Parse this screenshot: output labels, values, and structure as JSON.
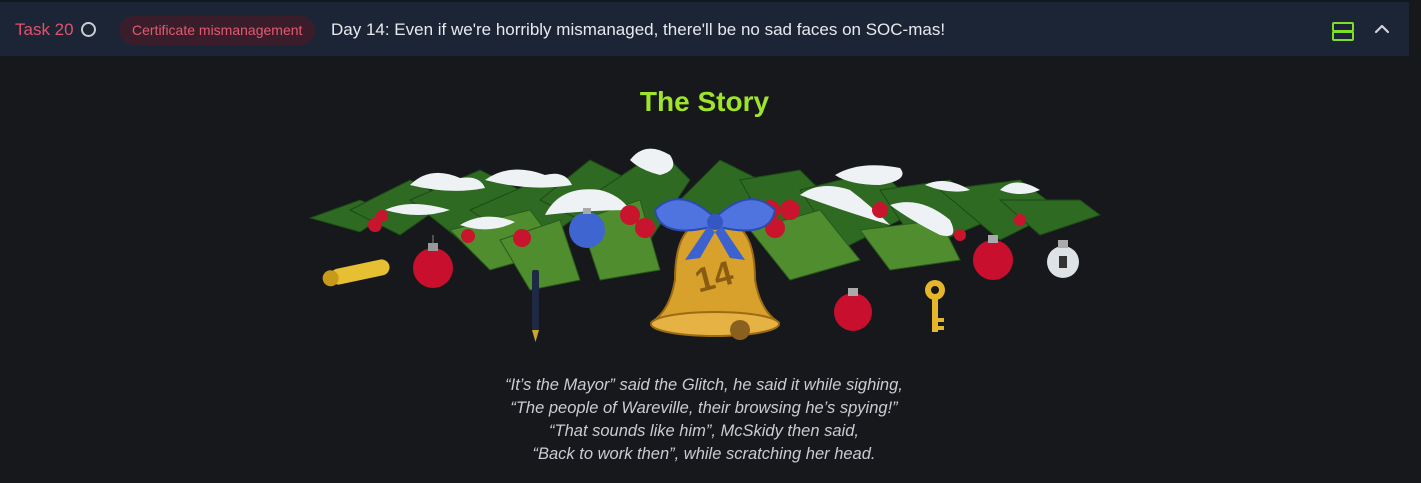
{
  "task": {
    "number_label": "Task 20",
    "tag": "Certificate mismanagement",
    "title": "Day 14: Even if we're horribly mismanaged, there'll be no sad faces on SOC-mas!"
  },
  "story": {
    "heading": "The Story",
    "bell_number": "14",
    "poem": [
      "“It’s the Mayor” said the Glitch, he said it while sighing,",
      "“The people of Wareville, their browsing he’s spying!”",
      "“That sounds like him”, McSkidy then said,",
      "“Back to work then”, while scratching her head."
    ]
  },
  "colors": {
    "accent_green": "#9ee42a",
    "task_red": "#e0526b",
    "header_bg": "#1c2536",
    "page_bg": "#17181c"
  }
}
